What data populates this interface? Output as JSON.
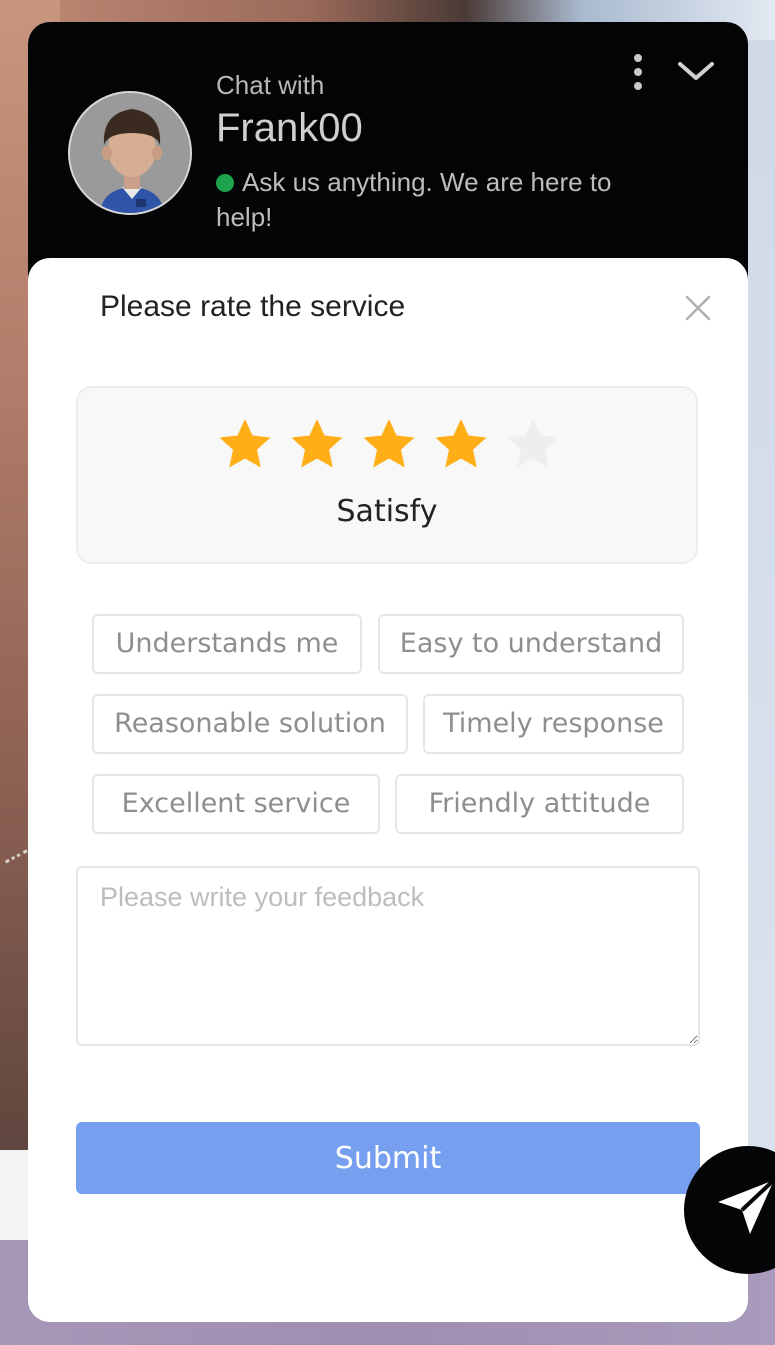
{
  "header": {
    "chat_with": "Chat with",
    "agent_name": "Frank00",
    "status_text": "Ask us anything. We are here to help!",
    "status_color": "#1ea34d",
    "avatar_icon": "agent-avatar-icon",
    "more_icon": "kebab-menu-icon",
    "collapse_icon": "chevron-down-icon"
  },
  "rating": {
    "title": "Please rate the service",
    "close_icon": "close-icon",
    "stars_selected": 4,
    "stars_total": 5,
    "star_filled_color": "#ffae17",
    "star_empty_color": "#eeeeee",
    "label": "Satisfy",
    "tags": [
      "Understands me",
      "Easy to understand",
      "Reasonable solution",
      "Timely response",
      "Excellent service",
      "Friendly attitude"
    ],
    "feedback_placeholder": "Please write your feedback",
    "submit_label": "Submit",
    "submit_color": "#779ff0"
  },
  "launcher": {
    "icon": "send-paper-plane-icon"
  }
}
